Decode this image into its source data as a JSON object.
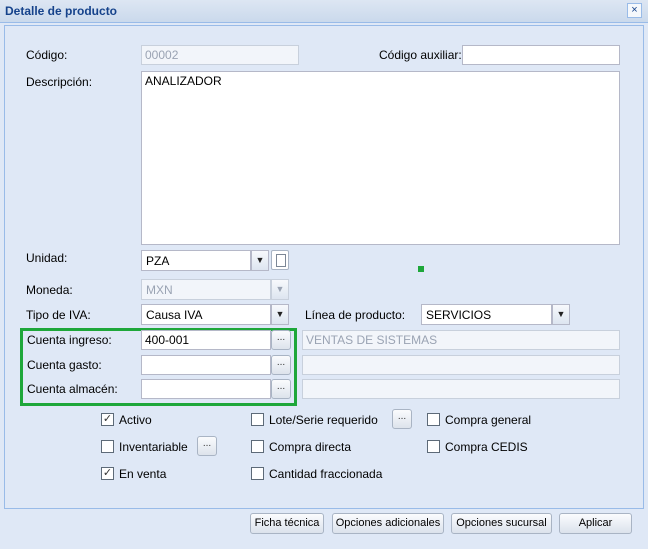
{
  "window": {
    "title": "Detalle de producto",
    "close": "×"
  },
  "labels": {
    "codigo": "Código:",
    "codigo_aux": "Código auxiliar:",
    "descripcion": "Descripción:",
    "unidad": "Unidad:",
    "moneda": "Moneda:",
    "tipo_iva": "Tipo de IVA:",
    "linea": "Línea de producto:",
    "cuenta_ingreso": "Cuenta ingreso:",
    "cuenta_gasto": "Cuenta gasto:",
    "cuenta_almacen": "Cuenta almacén:"
  },
  "values": {
    "codigo": "00002",
    "codigo_aux": "",
    "descripcion": "ANALIZADOR",
    "unidad": "PZA",
    "moneda": "MXN",
    "tipo_iva": "Causa IVA",
    "linea": "SERVICIOS",
    "cuenta_ingreso": "400-001",
    "cuenta_ingreso_desc": "VENTAS DE SISTEMAS",
    "cuenta_gasto": "",
    "cuenta_gasto_desc": "",
    "cuenta_almacen": "",
    "cuenta_almacen_desc": ""
  },
  "checkboxes": {
    "activo": {
      "label": "Activo",
      "checked": true
    },
    "inventariable": {
      "label": "Inventariable",
      "checked": false
    },
    "en_venta": {
      "label": "En venta",
      "checked": true
    },
    "lote_serie": {
      "label": "Lote/Serie requerido",
      "checked": false
    },
    "compra_directa": {
      "label": "Compra directa",
      "checked": false
    },
    "cantidad_fraccionada": {
      "label": "Cantidad fraccionada",
      "checked": false
    },
    "compra_general": {
      "label": "Compra general",
      "checked": false
    },
    "compra_cedis": {
      "label": "Compra CEDIS",
      "checked": false
    }
  },
  "buttons": {
    "ficha": "Ficha técnica",
    "opciones_adicionales": "Opciones adicionales",
    "opciones_sucursal": "Opciones sucursal",
    "aplicar": "Aplicar",
    "dots": "...",
    "dropdown": "▼",
    "check": "✓"
  },
  "colors": {
    "highlight": "#1ea73a",
    "title": "#15428b"
  }
}
